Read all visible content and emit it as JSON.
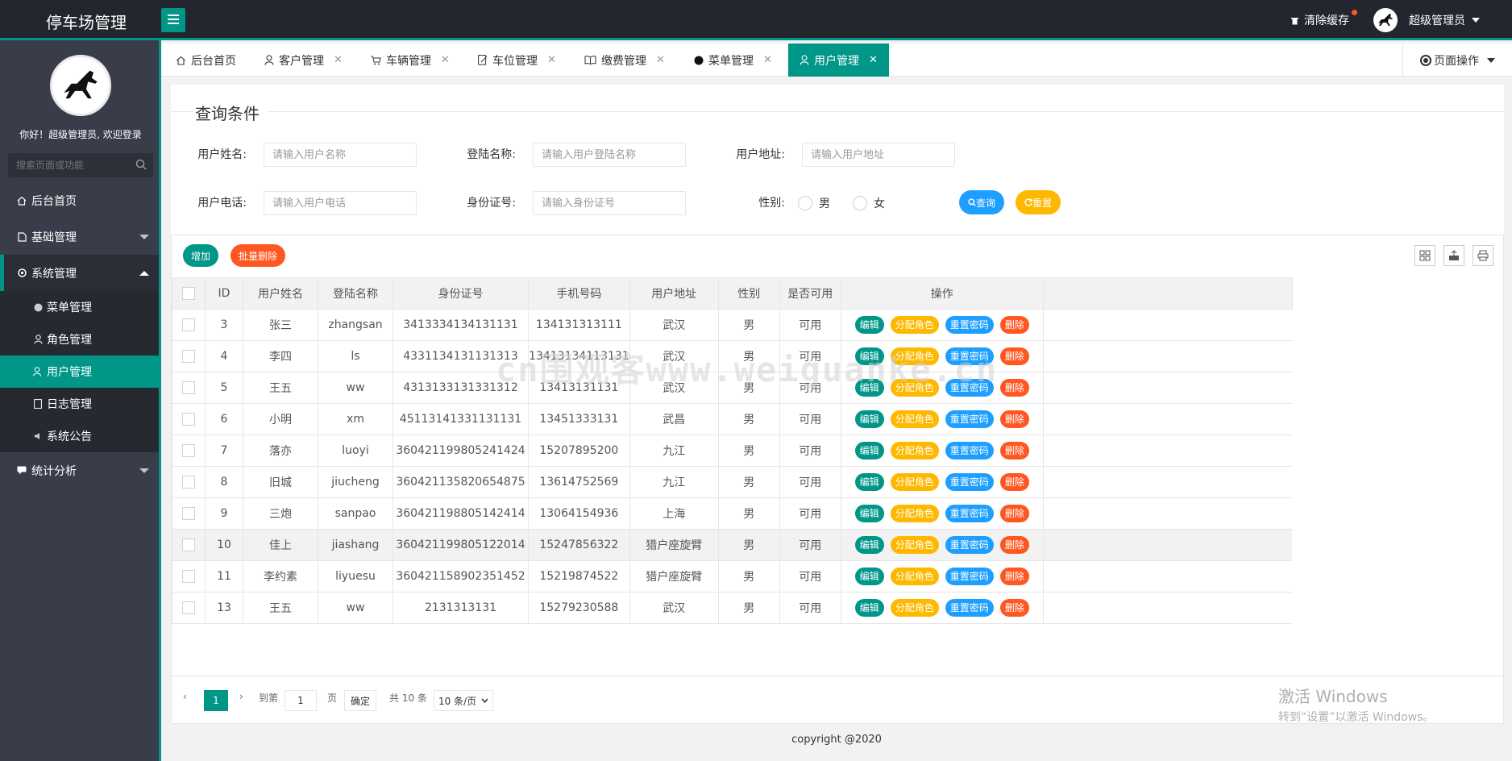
{
  "header": {
    "app_title": "停车场管理",
    "clear_cache": "清除缓存",
    "user_name": "超级管理员"
  },
  "sidebar": {
    "welcome": "你好！超级管理员, 欢迎登录",
    "search_placeholder": "搜索页面或功能",
    "items": [
      {
        "label": "后台首页",
        "icon": "home-icon"
      },
      {
        "label": "基础管理",
        "icon": "file-icon"
      },
      {
        "label": "系统管理",
        "icon": "gear-icon"
      },
      {
        "label": "统计分析",
        "icon": "chat-icon"
      }
    ],
    "sub_items": [
      {
        "label": "菜单管理",
        "icon": "circle-icon"
      },
      {
        "label": "角色管理",
        "icon": "user-icon"
      },
      {
        "label": "用户管理",
        "icon": "users-icon"
      },
      {
        "label": "日志管理",
        "icon": "note-icon"
      },
      {
        "label": "系统公告",
        "icon": "speaker-icon"
      }
    ]
  },
  "tabs": [
    {
      "label": "后台首页",
      "icon": "home-icon"
    },
    {
      "label": "客户管理",
      "icon": "user-icon"
    },
    {
      "label": "车辆管理",
      "icon": "cart-icon"
    },
    {
      "label": "车位管理",
      "icon": "edit-icon"
    },
    {
      "label": "缴费管理",
      "icon": "book-icon"
    },
    {
      "label": "菜单管理",
      "icon": "circle-icon"
    },
    {
      "label": "用户管理",
      "icon": "user-icon"
    }
  ],
  "page_ops": "页面操作",
  "query": {
    "title": "查询条件",
    "fields": [
      {
        "label": "用户姓名:",
        "placeholder": "请输入用户名称"
      },
      {
        "label": "登陆名称:",
        "placeholder": "请输入用户登陆名称"
      },
      {
        "label": "用户地址:",
        "placeholder": "请输入用户地址"
      },
      {
        "label": "用户电话:",
        "placeholder": "请输入用户电话"
      },
      {
        "label": "身份证号:",
        "placeholder": "请输入身份证号"
      }
    ],
    "gender_label": "性别:",
    "gender_male": "男",
    "gender_female": "女",
    "search_btn": "查询",
    "reset_btn": "重置"
  },
  "toolbar": {
    "add": "增加",
    "batch_delete": "批量删除"
  },
  "table": {
    "columns": [
      "ID",
      "用户姓名",
      "登陆名称",
      "身份证号",
      "手机号码",
      "用户地址",
      "性别",
      "是否可用",
      "操作"
    ],
    "rows": [
      {
        "id": "3",
        "name": "张三",
        "login": "zhangsan",
        "idcard": "3413334134131131",
        "phone": "134131313111",
        "addr": "武汉",
        "sex": "男",
        "avail": "可用"
      },
      {
        "id": "4",
        "name": "李四",
        "login": "ls",
        "idcard": "4331134131131313",
        "phone": "13413134113131",
        "addr": "武汉",
        "sex": "男",
        "avail": "可用"
      },
      {
        "id": "5",
        "name": "王五",
        "login": "ww",
        "idcard": "4313133131331312",
        "phone": "13413131131",
        "addr": "武汉",
        "sex": "男",
        "avail": "可用"
      },
      {
        "id": "6",
        "name": "小明",
        "login": "xm",
        "idcard": "45113141331131131",
        "phone": "13451333131",
        "addr": "武昌",
        "sex": "男",
        "avail": "可用"
      },
      {
        "id": "7",
        "name": "落亦",
        "login": "luoyi",
        "idcard": "360421199805241424",
        "phone": "15207895200",
        "addr": "九江",
        "sex": "男",
        "avail": "可用"
      },
      {
        "id": "8",
        "name": "旧城",
        "login": "jiucheng",
        "idcard": "360421135820654875",
        "phone": "13614752569",
        "addr": "九江",
        "sex": "男",
        "avail": "可用"
      },
      {
        "id": "9",
        "name": "三炮",
        "login": "sanpao",
        "idcard": "360421198805142414",
        "phone": "13064154936",
        "addr": "上海",
        "sex": "男",
        "avail": "可用"
      },
      {
        "id": "10",
        "name": "佳上",
        "login": "jiashang",
        "idcard": "360421199805122014",
        "phone": "15247856322",
        "addr": "猎户座旋臂",
        "sex": "男",
        "avail": "可用"
      },
      {
        "id": "11",
        "name": "李约素",
        "login": "liyuesu",
        "idcard": "360421158902351452",
        "phone": "15219874522",
        "addr": "猎户座旋臂",
        "sex": "男",
        "avail": "可用"
      },
      {
        "id": "13",
        "name": "王五",
        "login": "ww",
        "idcard": "2131313131",
        "phone": "15279230588",
        "addr": "武汉",
        "sex": "男",
        "avail": "可用"
      }
    ],
    "actions": {
      "edit": "编辑",
      "assign_role": "分配角色",
      "reset_pwd": "重置密码",
      "delete": "删除"
    }
  },
  "pager": {
    "current": "1",
    "goto": "到第",
    "page_input": "1",
    "page_unit": "页",
    "confirm": "确定",
    "total": "共 10 条",
    "per_page": "10 条/页"
  },
  "watermark": "cn围观客www.weiguanke.cn",
  "activate": {
    "line1": "激活 Windows",
    "line2": "转到“设置”以激活 Windows。"
  },
  "footer": "copyright @2020",
  "colors": {
    "primary": "#009688",
    "blue": "#1e9fff",
    "orange": "#ffb800",
    "red": "#ff5722",
    "dark": "#393d49"
  }
}
